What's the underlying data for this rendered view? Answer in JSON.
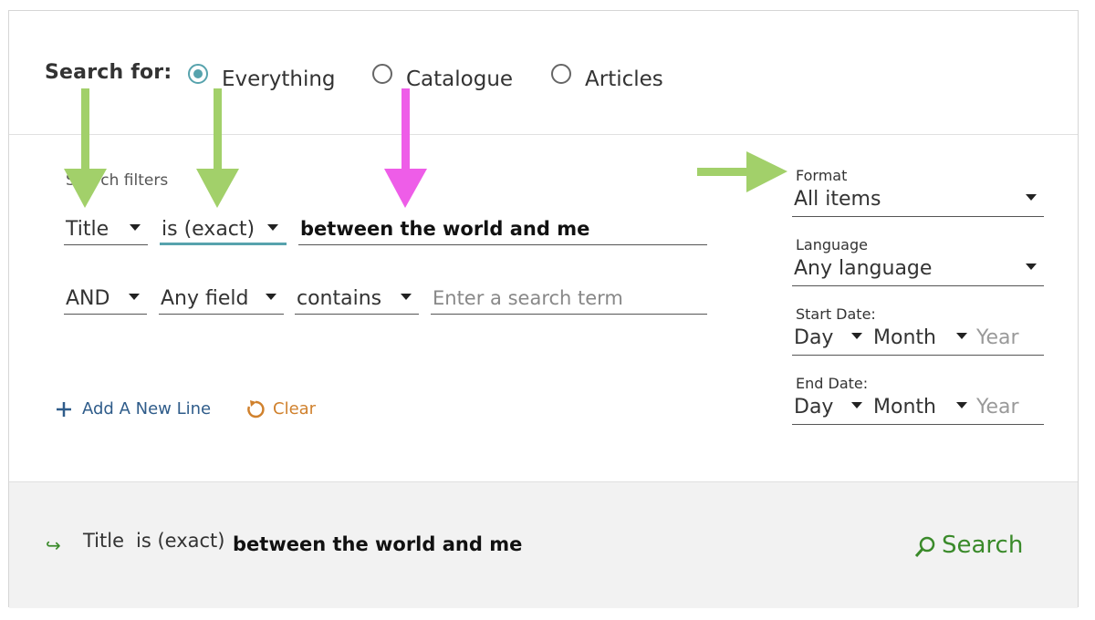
{
  "search_for": {
    "label": "Search for:",
    "options": [
      {
        "label": "Everything",
        "checked": true
      },
      {
        "label": "Catalogue",
        "checked": false
      },
      {
        "label": "Articles",
        "checked": false
      }
    ]
  },
  "filters": {
    "heading": "Search filters",
    "row1": {
      "field": "Title",
      "operator": "is (exact)",
      "term": "between the world and me"
    },
    "row2": {
      "boolean": "AND",
      "field": "Any field",
      "operator": "contains",
      "placeholder": "Enter a search term"
    }
  },
  "actions": {
    "add_line": "Add A New Line",
    "clear": "Clear"
  },
  "sidebar": {
    "format_label": "Format",
    "format_value": "All items",
    "language_label": "Language",
    "language_value": "Any language",
    "start_date_label": "Start Date:",
    "end_date_label": "End Date:",
    "day": "Day",
    "month": "Month",
    "year": "Year"
  },
  "summary": {
    "arrow": "↪",
    "field": "Title",
    "operator": "is (exact)",
    "term": "between the world and me",
    "search_button": "Search"
  },
  "colors": {
    "accent_teal": "#57a3ad",
    "arrow_green": "#a2d06a",
    "arrow_magenta": "#ee5de8",
    "search_green": "#3a8a2a",
    "clear_orange": "#d0812d",
    "link_blue": "#2f5c8a"
  }
}
